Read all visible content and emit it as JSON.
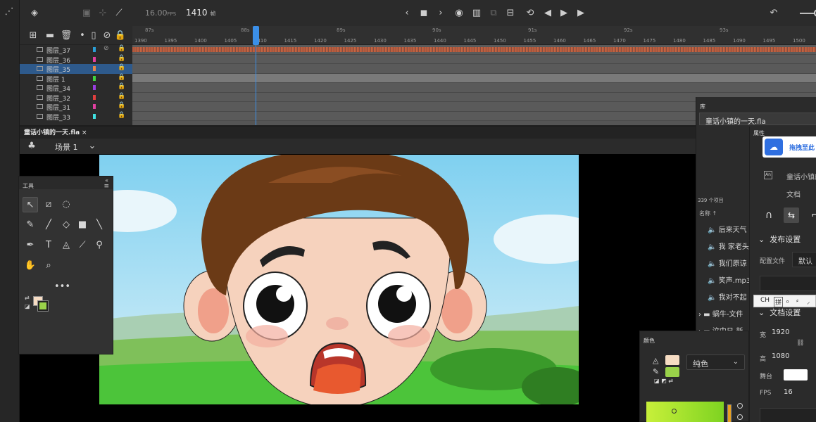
{
  "timeline": {
    "fps": "16.00",
    "fps_unit": "FPS",
    "current_frame": "1410",
    "frame_unit": "帧",
    "seconds": [
      "87s",
      "88s",
      "89s",
      "90s",
      "91s",
      "92s",
      "93s"
    ],
    "ticks": [
      "1390",
      "1395",
      "1400",
      "1405",
      "1410",
      "1415",
      "1420",
      "1425",
      "1430",
      "1435",
      "1440",
      "1445",
      "1450",
      "1455",
      "1460",
      "1465",
      "1470",
      "1475",
      "1480",
      "1485",
      "1490",
      "1495",
      "1500"
    ],
    "layers": [
      {
        "name": "图层_37",
        "color": "#2a9fd6"
      },
      {
        "name": "图层_36",
        "color": "#e43fa0"
      },
      {
        "name": "图层_35",
        "color": "#e8874a",
        "selected": true
      },
      {
        "name": "图层 1",
        "color": "#3fd43f"
      },
      {
        "name": "图层_34",
        "color": "#9a3fe0"
      },
      {
        "name": "图层_32",
        "color": "#e03f3f"
      },
      {
        "name": "图层_31",
        "color": "#e03fa0"
      },
      {
        "name": "图层_33",
        "color": "#3fe0e0"
      }
    ]
  },
  "document": {
    "tab": "童话小镇的一天.fla",
    "scene": "场景 1"
  },
  "tools": {
    "title": "工具"
  },
  "library": {
    "title": "库",
    "document": "童话小镇的一天.fla",
    "count": "339 个项目",
    "col_name": "名称",
    "items": [
      {
        "name": "后来天气",
        "icon": "sound-icon"
      },
      {
        "name": "我 家老头",
        "icon": "sound-icon"
      },
      {
        "name": "我们原谅",
        "icon": "sound-icon"
      },
      {
        "name": "笑声.mp3",
        "icon": "sound-icon"
      },
      {
        "name": "我对不起",
        "icon": "sound-icon"
      },
      {
        "name": "蜗牛-文件",
        "icon": "folder-icon"
      },
      {
        "name": "汶中日-新",
        "icon": "folder-icon"
      }
    ]
  },
  "properties": {
    "title": "属性",
    "baidu": "拖拽至此",
    "doc_name": "童话小镇的",
    "doc_type": "文档",
    "publish": "发布设置",
    "profile_label": "配置文件",
    "profile_value": "默认",
    "doc_settings": "文档设置",
    "width_label": "宽",
    "width": "1920",
    "height_label": "高",
    "height": "1080",
    "stage_label": "舞台",
    "fps_label": "FPS",
    "fps": "16"
  },
  "ime": {
    "mode": "CH",
    "pinyin": "拼"
  },
  "color": {
    "title": "颜色",
    "fill_type": "纯色",
    "fill_color": "#f6dcc3",
    "stroke_color": "#9ad24a"
  }
}
